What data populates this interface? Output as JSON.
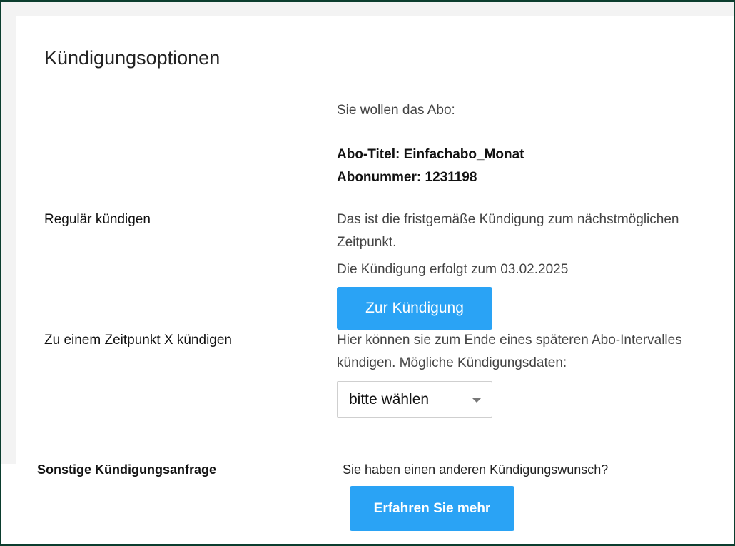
{
  "page": {
    "title": "Kündigungsoptionen"
  },
  "subscription": {
    "intro": "Sie wollen das Abo:",
    "title_line": "Abo-Titel: Einfachabo_Monat",
    "number_line": "Abonummer: 1231198"
  },
  "regular": {
    "label": "Regulär kündigen",
    "description_line1": "Das ist die fristgemäße Kündigung zum nächstmöglichen",
    "description_line2": "Zeitpunkt.",
    "date_text": "Die Kündigung erfolgt zum 03.02.2025",
    "button_label": "Zur Kündigung"
  },
  "custom_date": {
    "label": "Zu einem Zeitpunkt X kündigen",
    "description_line1": "Hier können sie zum Ende eines späteren Abo-Intervalles",
    "description_line2": "kündigen. Mögliche Kündigungsdaten:",
    "select_value": "bitte wählen"
  },
  "other": {
    "label": "Sonstige Kündigungsanfrage",
    "question": "Sie haben einen anderen Kündigungswunsch?",
    "button_label": "Erfahren Sie mehr"
  },
  "colors": {
    "accent": "#2aa3f5",
    "frame": "#0b3d2e",
    "background": "#f3f3f3"
  },
  "icons": {
    "select_arrow": "chevron-down-icon"
  }
}
